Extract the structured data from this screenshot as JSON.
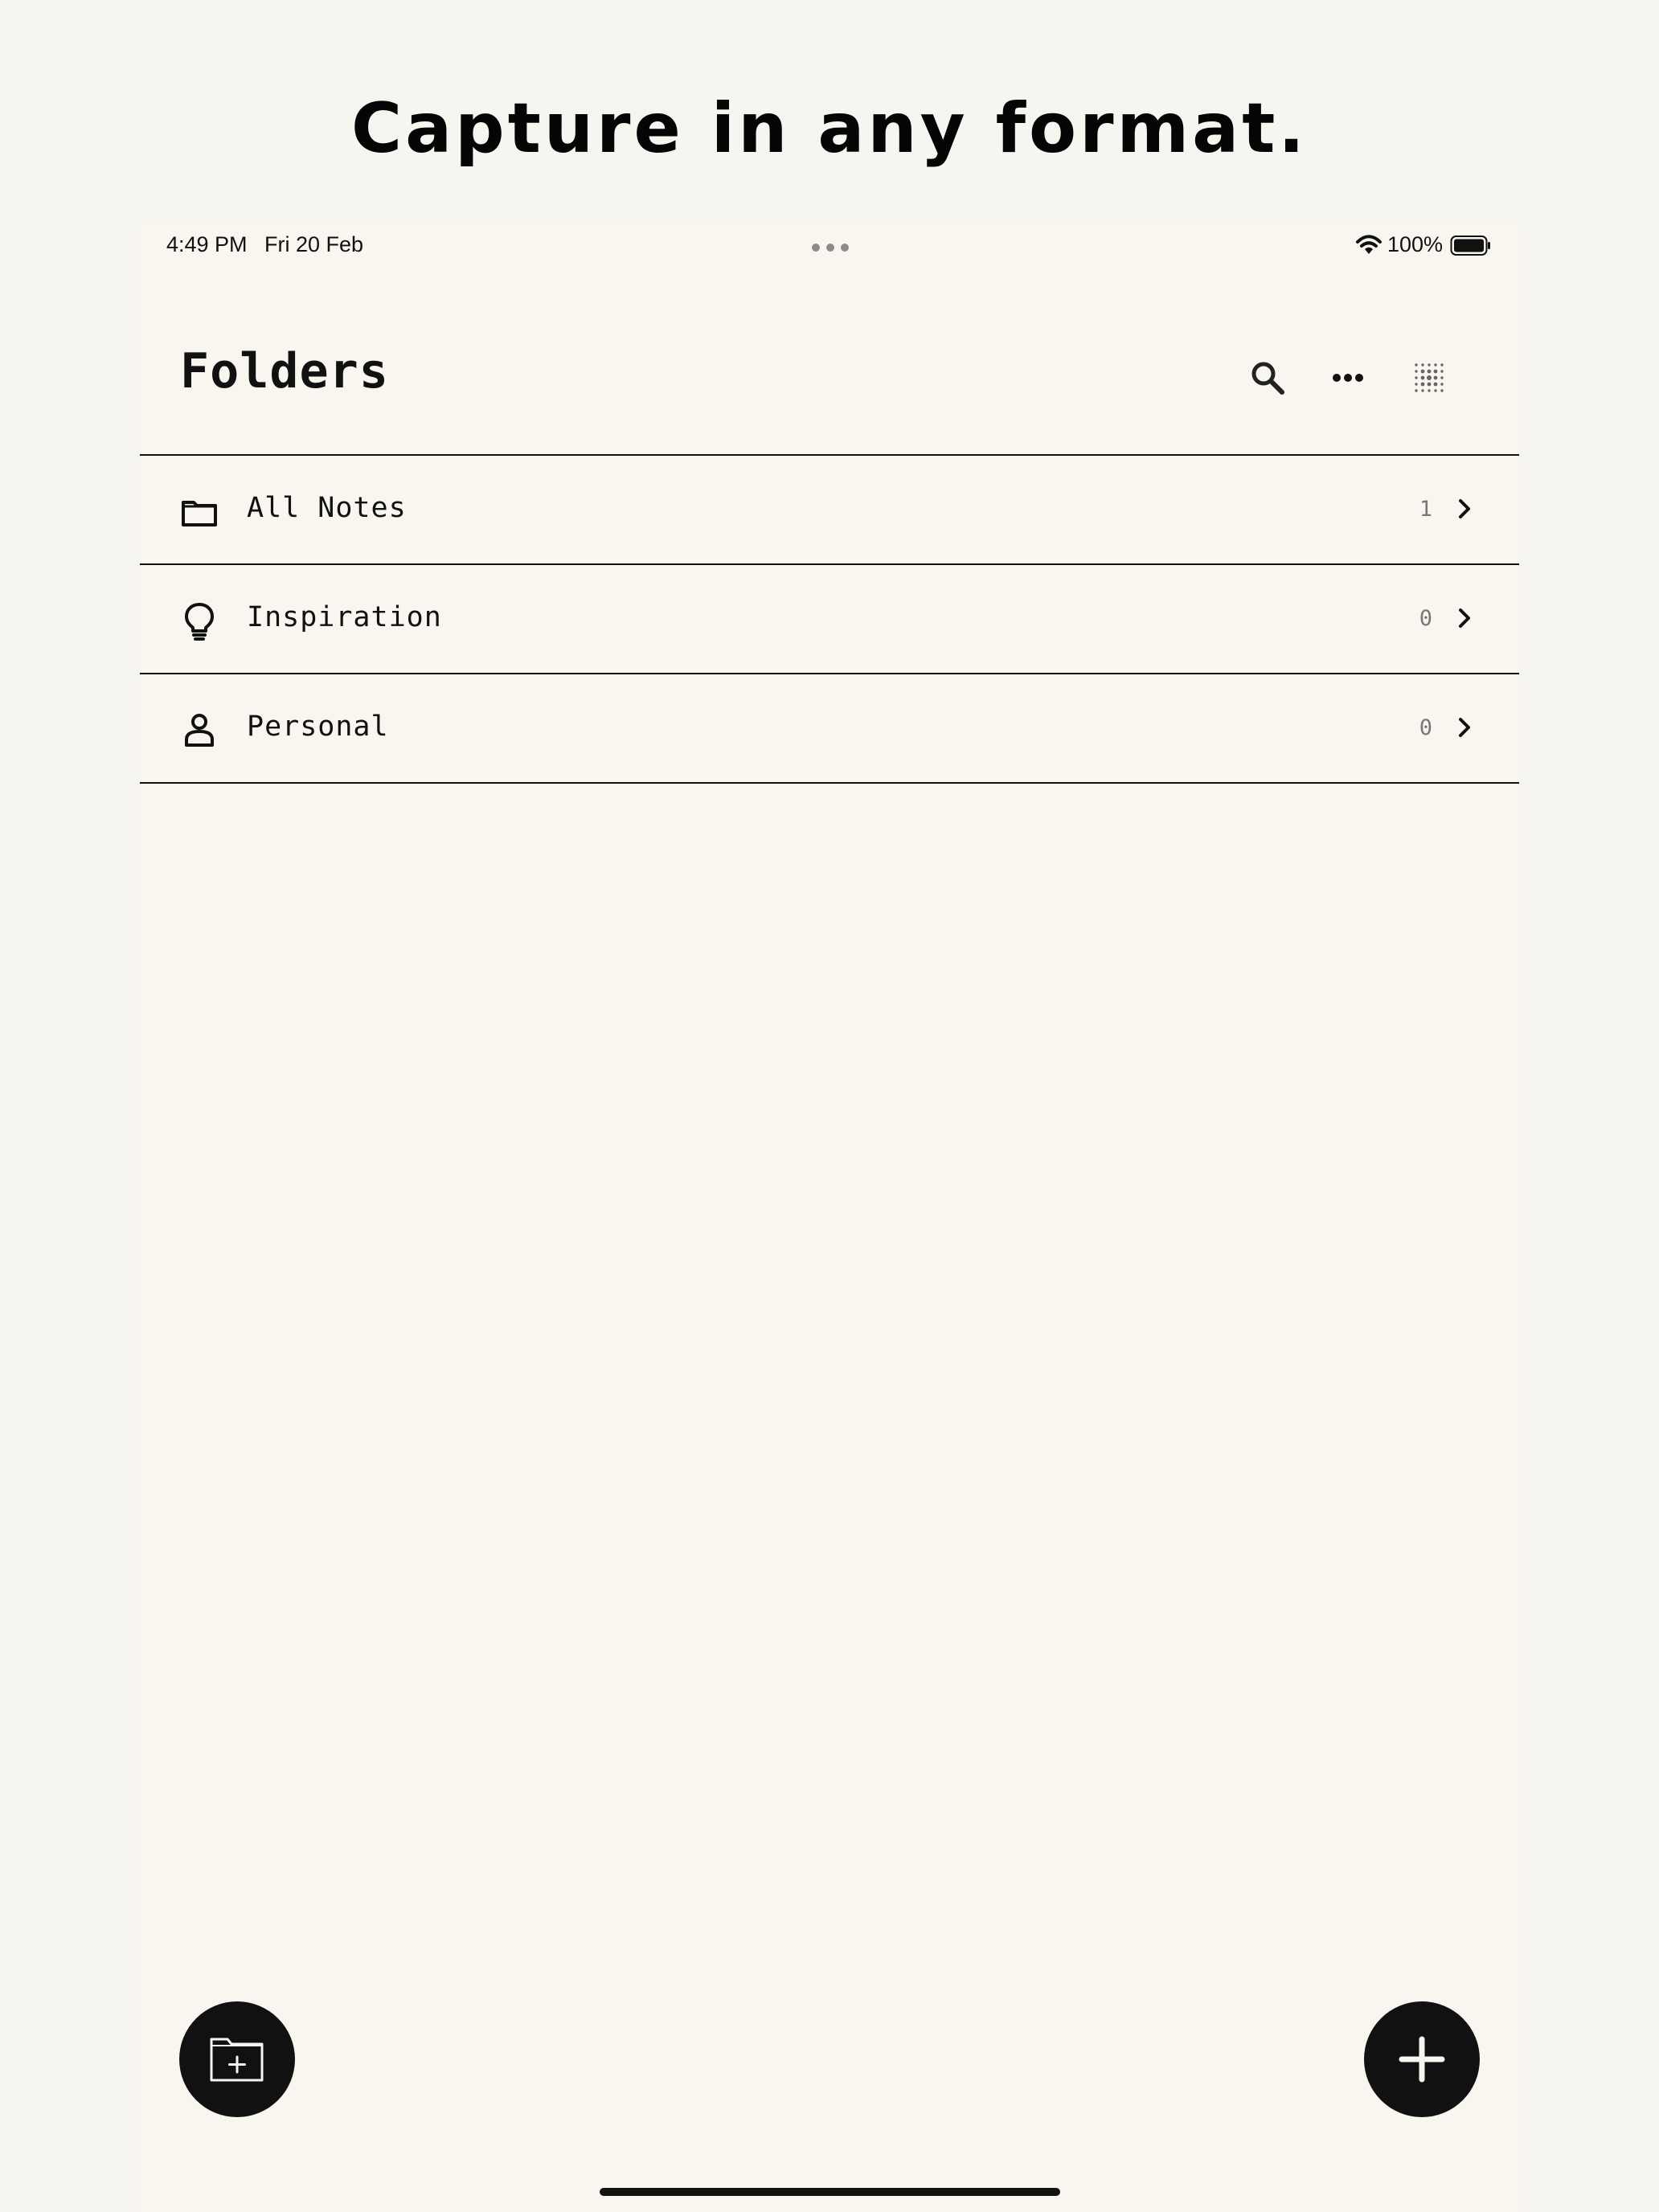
{
  "promo": {
    "headline": "Capture in any format."
  },
  "status_bar": {
    "time": "4:49 PM",
    "date": "Fri 20 Feb",
    "battery_percent": "100%",
    "battery_level": 1.0,
    "icons": [
      "multitask-dots-icon",
      "wifi-icon",
      "battery-icon"
    ]
  },
  "header": {
    "title": "Folders",
    "actions": [
      {
        "name": "search",
        "icon": "search-icon"
      },
      {
        "name": "more",
        "icon": "ellipsis-icon"
      },
      {
        "name": "grid",
        "icon": "dot-grid-icon"
      }
    ]
  },
  "folders": [
    {
      "name": "All Notes",
      "count": "1",
      "icon": "folder-icon"
    },
    {
      "name": "Inspiration",
      "count": "0",
      "icon": "lightbulb-icon"
    },
    {
      "name": "Personal",
      "count": "0",
      "icon": "person-icon"
    }
  ],
  "actions": {
    "new_folder_icon": "folder-plus-icon",
    "new_note_icon": "plus-icon"
  },
  "colors": {
    "background": "#f7f5ef",
    "text": "#111111",
    "muted": "#777777",
    "button": "#111111"
  }
}
